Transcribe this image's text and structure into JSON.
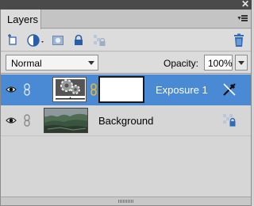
{
  "window": {
    "close_glyph": "✕"
  },
  "tabs": [
    {
      "label": "Layers"
    }
  ],
  "toolbar": {
    "icons": [
      "new-layer-icon",
      "adjustment-layer-icon",
      "layer-mask-icon",
      "lock-icon",
      "lock-transparent-icon",
      "trash-icon"
    ]
  },
  "controls": {
    "blend_mode": "Normal",
    "opacity_label": "Opacity:",
    "opacity_value": "100%"
  },
  "layers": [
    {
      "name": "Exposure 1",
      "selected": true,
      "type": "adjustment"
    },
    {
      "name": "Background",
      "selected": false,
      "type": "image"
    }
  ],
  "colors": {
    "selected_row": "#4a8ad4",
    "panel_bg": "#d6d6d6",
    "titlebar": "#4a4a4a",
    "trash_blue": "#2e6bb8"
  }
}
